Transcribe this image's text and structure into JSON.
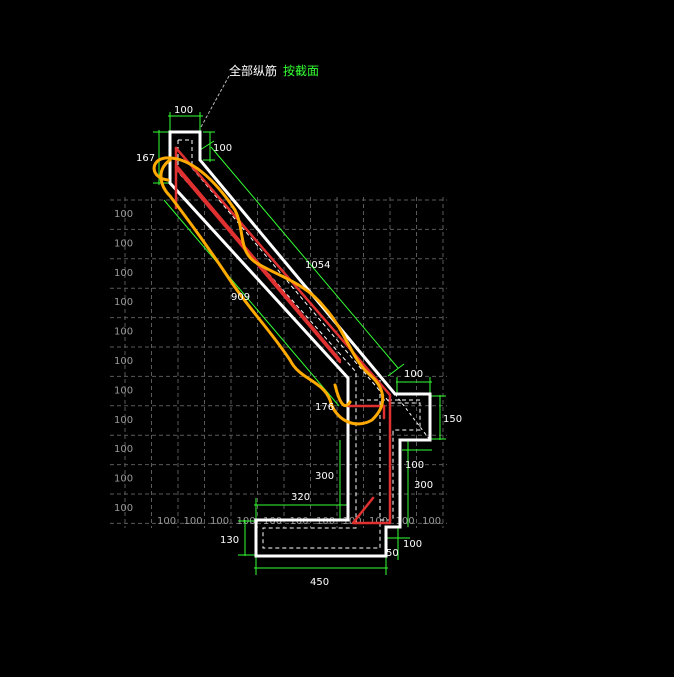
{
  "annotation": {
    "text_white": "全部纵筋",
    "text_green": "按截面"
  },
  "colors": {
    "background": "#000000",
    "outline": "#ffffff",
    "dimension": "#33ff33",
    "grid": "#6a6a6a",
    "rebar": "#e03030",
    "markup": "#ffaa00"
  },
  "grid_labels": {
    "rows": [
      "100",
      "100",
      "100",
      "100",
      "100",
      "100",
      "100",
      "100",
      "100",
      "100",
      "100",
      "100",
      "100",
      "100",
      "100",
      "100",
      "100",
      "100",
      "100"
    ],
    "cols": [
      "100",
      "100",
      "100",
      "100",
      "100",
      "100",
      "100",
      "100",
      "100",
      "100",
      "100",
      "100",
      "100",
      "100"
    ]
  },
  "dimensions": {
    "top_width": "100",
    "top_right": "100",
    "left_167": "167",
    "diag_1054": "1054",
    "diag_909": "909",
    "step_100_top": "100",
    "right_150": "150",
    "inner_176": "176",
    "right_100": "100",
    "left_300": "300",
    "right_300": "300",
    "bottom_320": "320",
    "left_130": "130",
    "bottom_50": "50",
    "bottom_right_100": "100",
    "bottom_450": "450"
  }
}
